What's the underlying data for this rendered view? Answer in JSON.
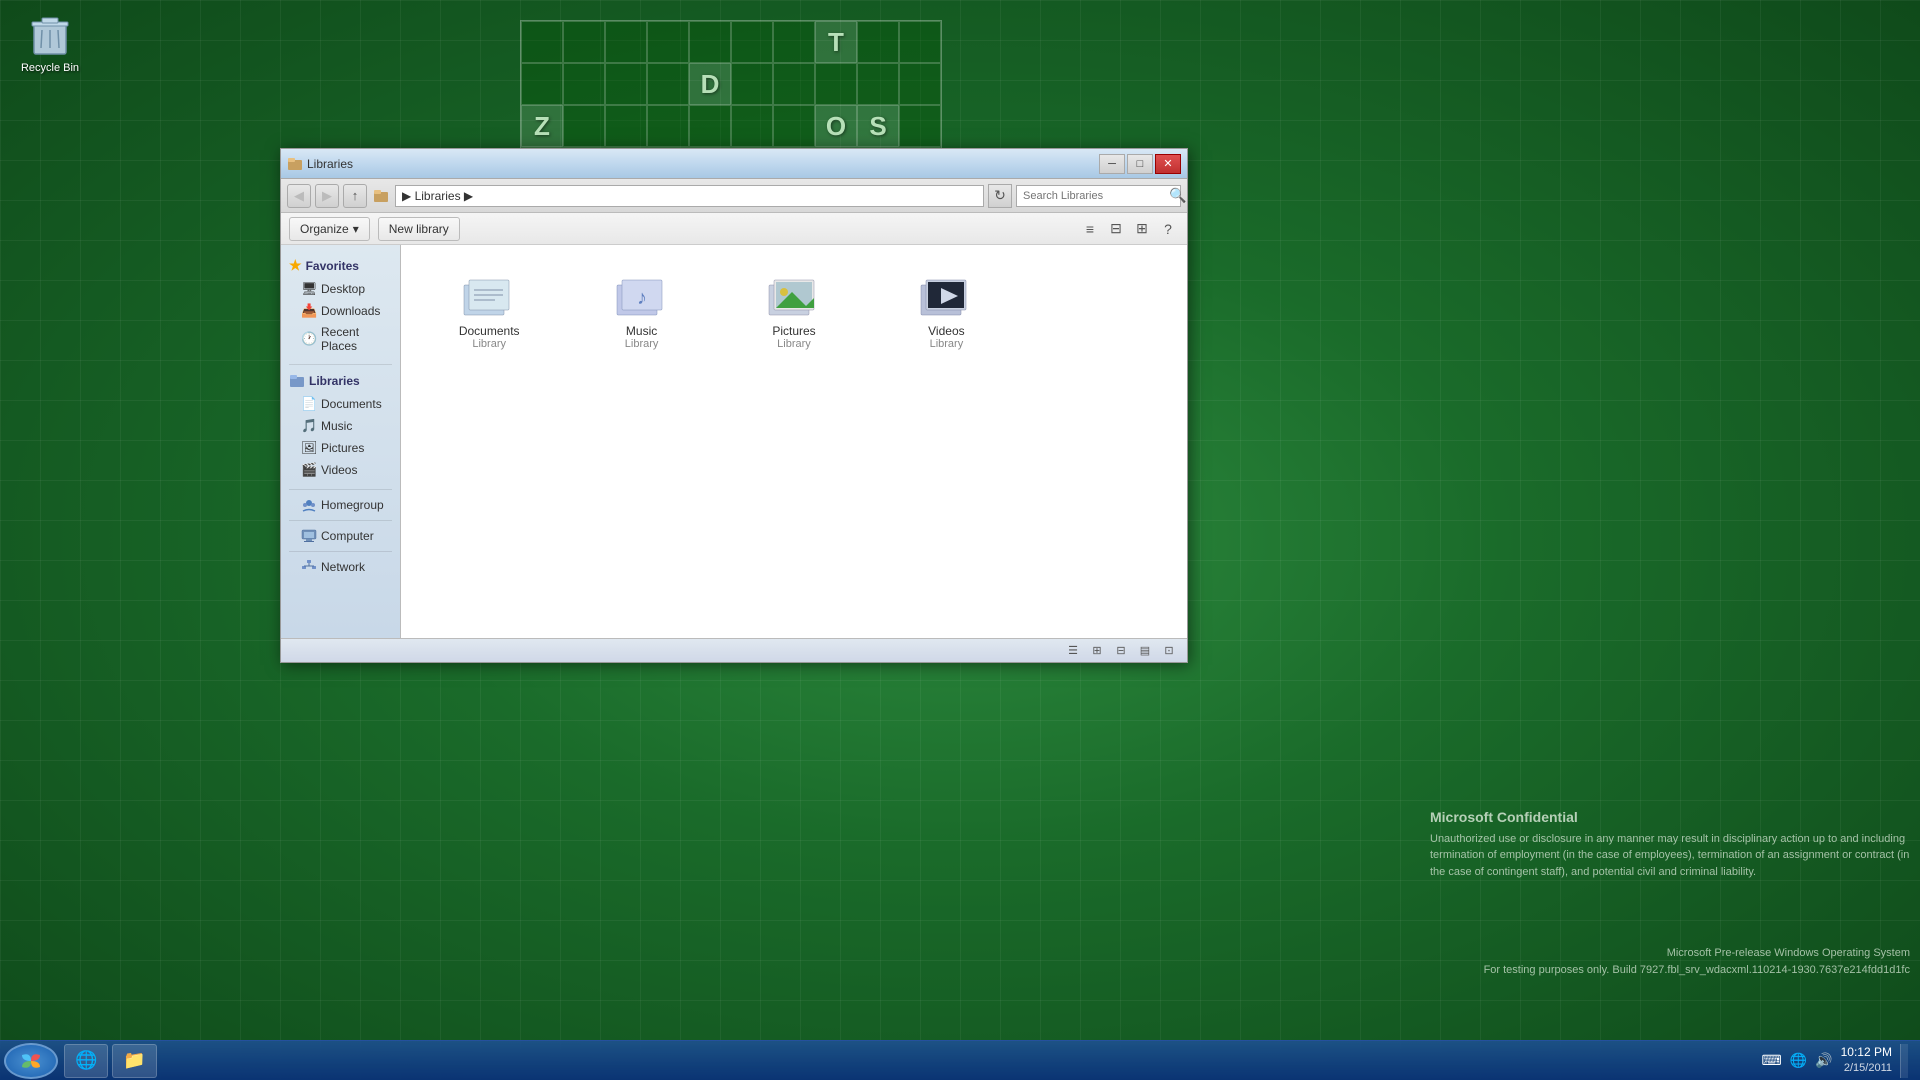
{
  "desktop": {
    "background_color": "#1a6b2a",
    "recycle_bin": {
      "label": "Recycle Bin",
      "icon": "🗑"
    }
  },
  "crossword": {
    "cells": [
      [
        "",
        "",
        "",
        "",
        "",
        "",
        "",
        "T",
        "",
        ""
      ],
      [
        "",
        "",
        "",
        "",
        "D",
        "",
        "",
        "",
        "",
        ""
      ],
      [
        "Z",
        "",
        "",
        "",
        "",
        "",
        "",
        "O",
        "S",
        ""
      ],
      [
        "",
        "",
        "",
        "",
        "",
        "",
        "",
        "",
        "",
        ""
      ]
    ]
  },
  "confidential": {
    "title": "Microsoft Confidential",
    "body": "Unauthorized use or disclosure in any manner may result in disciplinary action up to and including termination of employment (in the case of employees), termination of an assignment or contract (in the case of contingent staff), and potential civil and criminal liability."
  },
  "build_info": {
    "line1": "Microsoft Pre-release Windows Operating System",
    "line2": "For testing purposes only. Build 7927.fbl_srv_wdacxml.110214-1930.7637e214fdd1d1fc"
  },
  "explorer": {
    "title": "Libraries",
    "address": "Libraries",
    "address_path": "▶ Libraries ▶",
    "search_placeholder": "Search Libraries",
    "toolbar": {
      "organize_label": "Organize",
      "new_library_label": "New library"
    },
    "sidebar": {
      "favorites_label": "Favorites",
      "items_favorites": [
        {
          "label": "Desktop",
          "icon": "🖥"
        },
        {
          "label": "Downloads",
          "icon": "📥"
        },
        {
          "label": "Recent Places",
          "icon": "🕐"
        }
      ],
      "libraries_label": "Libraries",
      "items_libraries": [
        {
          "label": "Documents",
          "icon": "📄"
        },
        {
          "label": "Music",
          "icon": "🎵"
        },
        {
          "label": "Pictures",
          "icon": "🖼"
        },
        {
          "label": "Videos",
          "icon": "🎬"
        }
      ],
      "homegroup_label": "Homegroup",
      "computer_label": "Computer",
      "network_label": "Network"
    },
    "libraries": [
      {
        "name": "Documents",
        "type": "Library"
      },
      {
        "name": "Music",
        "type": "Library"
      },
      {
        "name": "Pictures",
        "type": "Library"
      },
      {
        "name": "Videos",
        "type": "Library"
      }
    ],
    "status_bar": {
      "views": [
        "⊞",
        "☰",
        "⊟",
        "▤",
        "⊡"
      ]
    }
  },
  "taskbar": {
    "start_icon": "⊞",
    "pinned": [
      {
        "icon": "🌐",
        "label": "Internet Explorer"
      },
      {
        "icon": "📁",
        "label": "Windows Explorer"
      }
    ],
    "clock": {
      "time": "10:12 PM",
      "date": "2/15/2011"
    },
    "notification_area": {
      "icons": [
        "🔊",
        "🌐",
        "⌨"
      ]
    }
  }
}
